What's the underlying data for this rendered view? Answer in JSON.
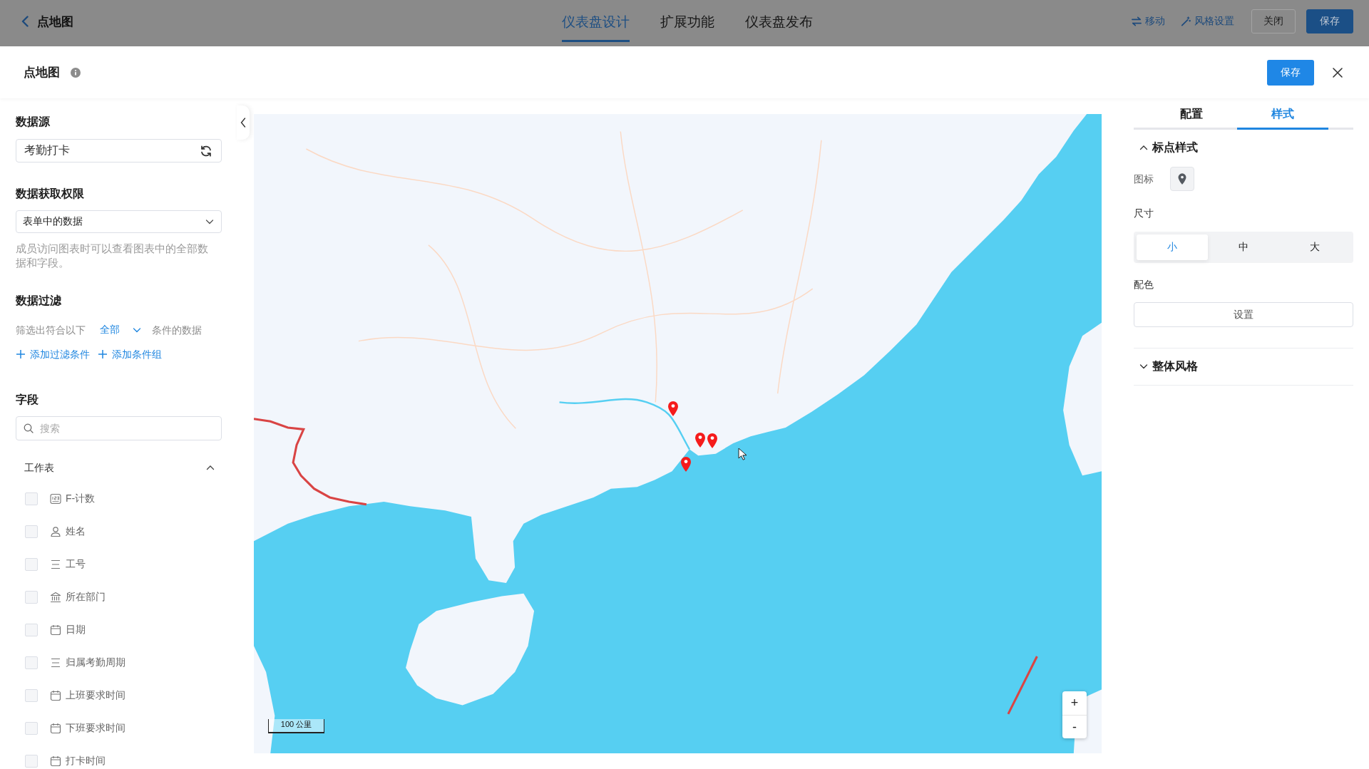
{
  "top_bar": {
    "title": "点地图",
    "tabs": [
      {
        "label": "仪表盘设计",
        "selected": true
      },
      {
        "label": "扩展功能",
        "selected": false
      },
      {
        "label": "仪表盘发布",
        "selected": false
      }
    ],
    "actions": [
      {
        "kind": "move",
        "label": "移动"
      },
      {
        "kind": "style",
        "label": "风格设置"
      }
    ],
    "buttons": [
      {
        "kind": "default",
        "label": "关闭"
      },
      {
        "kind": "primary",
        "label": "保存"
      }
    ]
  },
  "dialog": {
    "title": "点地图",
    "save_button": "保存"
  },
  "left_panel": {
    "data_source": {
      "heading": "数据源",
      "value": "考勤打卡"
    },
    "permission": {
      "heading": "数据获取权限",
      "value": "表单中的数据",
      "help": "成员访问图表时可以查看图表中的全部数据和字段。"
    },
    "filter": {
      "heading": "数据过滤",
      "prefix": "筛选出符合以下",
      "mode": "全部",
      "suffix": "条件的数据",
      "links": [
        "添加过滤条件",
        "添加条件组"
      ]
    },
    "fields": {
      "heading": "字段",
      "search_placeholder": "搜索",
      "group": {
        "label": "工作表",
        "expanded": true,
        "items": [
          {
            "kind": "number",
            "label": "F-计数",
            "checked": false
          },
          {
            "kind": "member",
            "label": "姓名",
            "checked": false
          },
          {
            "kind": "text",
            "label": "工号",
            "checked": false
          },
          {
            "kind": "department",
            "label": "所在部门",
            "checked": false
          },
          {
            "kind": "date",
            "label": "日期",
            "checked": false
          },
          {
            "kind": "text",
            "label": "归属考勤周期",
            "checked": false
          },
          {
            "kind": "date",
            "label": "上班要求时间",
            "checked": false
          },
          {
            "kind": "date",
            "label": "下班要求时间",
            "checked": false
          },
          {
            "kind": "date",
            "label": "打卡时间",
            "checked": false
          }
        ]
      }
    }
  },
  "map": {
    "scale_label": "100 公里",
    "zoom_in": "+",
    "zoom_out": "-"
  },
  "right_panel": {
    "tabs": [
      {
        "label": "配置",
        "selected": false
      },
      {
        "label": "样式",
        "selected": true
      }
    ],
    "sections": [
      {
        "title": "标点样式",
        "expanded": true,
        "icon_label": "图标",
        "size_label": "尺寸",
        "sizes": [
          {
            "label": "小",
            "selected": true
          },
          {
            "label": "中",
            "selected": false
          },
          {
            "label": "大",
            "selected": false
          }
        ],
        "color_label": "配色",
        "color_button": "设置"
      },
      {
        "title": "整体风格",
        "expanded": false
      }
    ]
  }
}
